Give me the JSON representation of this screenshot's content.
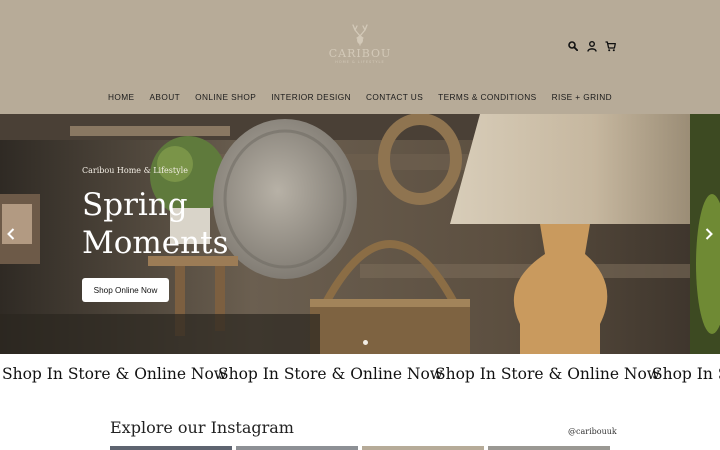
{
  "header": {
    "logo_text": "CARIBOU",
    "logo_sub": "HOME & LIFESTYLE",
    "icons": [
      "search-icon",
      "account-icon",
      "cart-icon"
    ],
    "background": "#b7ab98"
  },
  "nav": {
    "items": [
      "HOME",
      "ABOUT",
      "ONLINE SHOP",
      "INTERIOR DESIGN",
      "CONTACT US",
      "TERMS & CONDITIONS",
      "RISE + GRIND"
    ]
  },
  "hero": {
    "kicker": "Caribou Home & Lifestyle",
    "title_line1": "Spring",
    "title_line2": "Moments",
    "button_label": "Shop Online Now",
    "prev_icon": "chevron-left-icon",
    "next_icon": "chevron-right-icon",
    "active_slide": 1
  },
  "marquee": {
    "text": "Shop In Store & Online Now"
  },
  "instagram": {
    "title": "Explore our Instagram",
    "handle": "@caribouuk"
  }
}
